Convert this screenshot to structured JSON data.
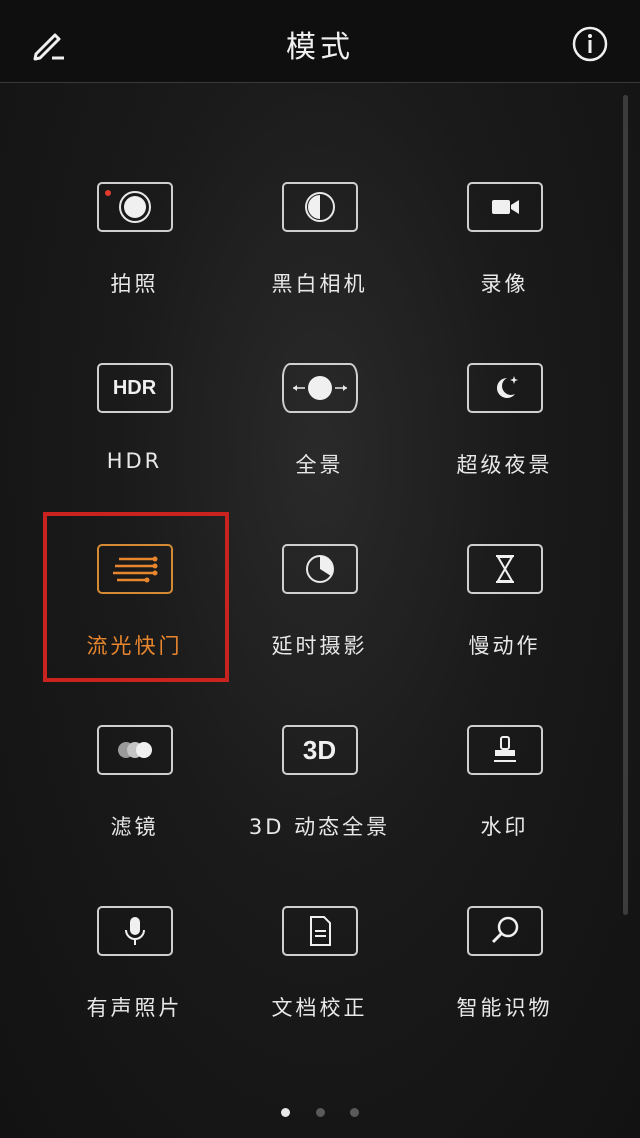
{
  "header": {
    "title": "模式",
    "edit_icon": "edit-icon",
    "info_icon": "info-icon"
  },
  "modes": [
    {
      "label": "拍照",
      "icon": "camera-icon"
    },
    {
      "label": "黑白相机",
      "icon": "monochrome-icon"
    },
    {
      "label": "录像",
      "icon": "video-icon"
    },
    {
      "label": "HDR",
      "icon": "hdr-icon"
    },
    {
      "label": "全景",
      "icon": "panorama-icon"
    },
    {
      "label": "超级夜景",
      "icon": "night-icon"
    },
    {
      "label": "流光快门",
      "icon": "light-painting-icon",
      "selected": true
    },
    {
      "label": "延时摄影",
      "icon": "timelapse-icon"
    },
    {
      "label": "慢动作",
      "icon": "slow-motion-icon"
    },
    {
      "label": "滤镜",
      "icon": "filter-icon"
    },
    {
      "label": "3D 动态全景",
      "icon": "3d-panorama-icon"
    },
    {
      "label": "水印",
      "icon": "watermark-icon"
    },
    {
      "label": "有声照片",
      "icon": "audio-photo-icon"
    },
    {
      "label": "文档校正",
      "icon": "document-icon"
    },
    {
      "label": "智能识物",
      "icon": "search-icon"
    }
  ],
  "pagination": {
    "current": 1,
    "total": 3
  },
  "colors": {
    "accent": "#e8862e",
    "highlight": "#c8231e",
    "background": "#1a1a1a"
  }
}
